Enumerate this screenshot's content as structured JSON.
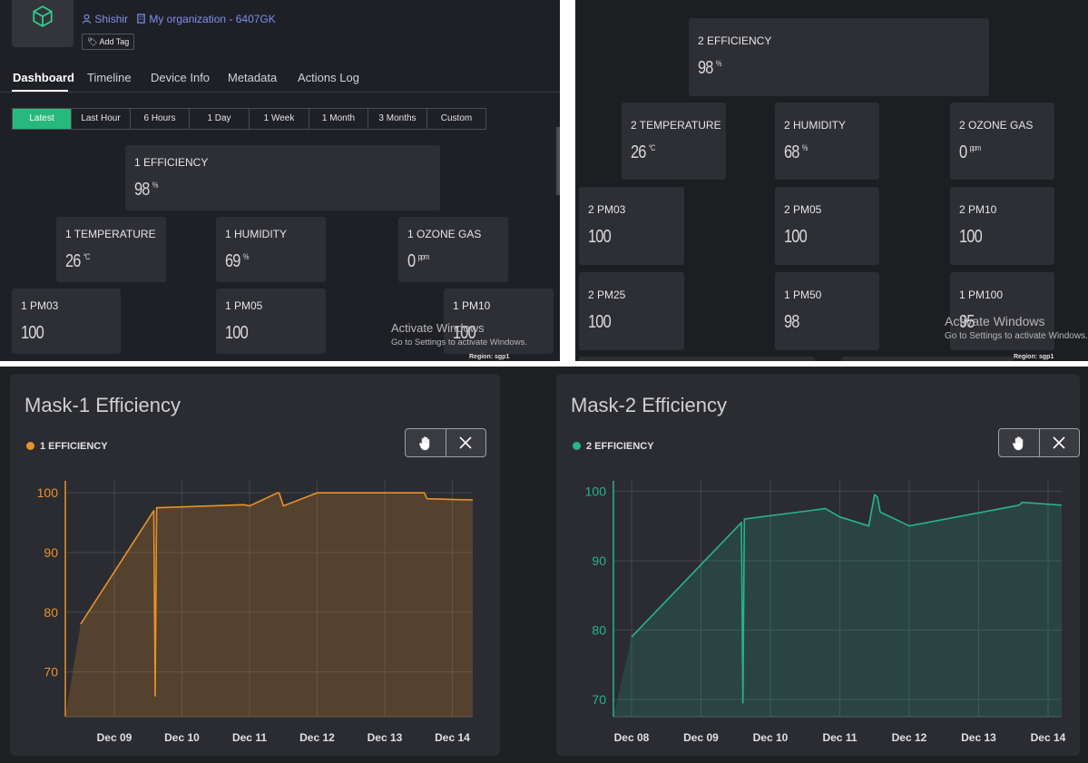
{
  "header": {
    "user_name": "Shishir",
    "org_name": "My organization - 6407GK",
    "add_tag_label": "Add Tag"
  },
  "tabs": [
    "Dashboard",
    "Timeline",
    "Device Info",
    "Metadata",
    "Actions Log"
  ],
  "time_ranges": [
    "Latest",
    "Last Hour",
    "6 Hours",
    "1 Day",
    "1 Week",
    "1 Month",
    "3 Months",
    "Custom"
  ],
  "mask1_cards": {
    "efficiency": {
      "label": "1 EFFICIENCY",
      "value": "98",
      "unit": "%"
    },
    "temperature": {
      "label": "1 TEMPERATURE",
      "value": "26",
      "unit": "°C"
    },
    "humidity": {
      "label": "1 HUMIDITY",
      "value": "69",
      "unit": "%"
    },
    "ozone": {
      "label": "1 OZONE GAS",
      "value": "0",
      "unit": "ppm"
    },
    "pm03": {
      "label": "1 PM03",
      "value": "100"
    },
    "pm05": {
      "label": "1 PM05",
      "value": "100"
    },
    "pm10": {
      "label": "1 PM10",
      "value": "100"
    }
  },
  "mask2_cards": {
    "efficiency": {
      "label": "2 EFFICIENCY",
      "value": "98",
      "unit": "%"
    },
    "temperature": {
      "label": "2 TEMPERATURE",
      "value": "26",
      "unit": "°C"
    },
    "humidity": {
      "label": "2 HUMIDITY",
      "value": "68",
      "unit": "%"
    },
    "ozone": {
      "label": "2 OZONE GAS",
      "value": "0",
      "unit": "ppm"
    },
    "pm03": {
      "label": "2 PM03",
      "value": "100"
    },
    "pm05": {
      "label": "2 PM05",
      "value": "100"
    },
    "pm10": {
      "label": "2 PM10",
      "value": "100"
    },
    "pm25": {
      "label": "2 PM25",
      "value": "100"
    },
    "pm50": {
      "label": "1 PM50",
      "value": "98"
    },
    "pm100": {
      "label": "1 PM100",
      "value": "95"
    }
  },
  "watermark": {
    "title": "Activate Windows",
    "subtitle": "Go to Settings to activate Windows."
  },
  "footer_region": "Region: sgp1",
  "colors": {
    "accent_green": "#27b97b",
    "mask1_line": "#e8922a",
    "mask2_line": "#26b58a"
  },
  "chart_data": [
    {
      "type": "area",
      "title": "Mask-1 Efficiency",
      "series": [
        {
          "name": "1 EFFICIENCY",
          "color": "#e8922a",
          "x": [
            "2023-12-08T12:00",
            "2023-12-09T14:00",
            "2023-12-09T14:30",
            "2023-12-09T15:00",
            "2023-12-09T16:00",
            "2023-12-10T22:00",
            "2023-12-11T00:00",
            "2023-12-11T10:00",
            "2023-12-11T10:30",
            "2023-12-11T12:00",
            "2023-12-12T00:00",
            "2023-12-13T14:00",
            "2023-12-13T15:00",
            "2023-12-14T12:00"
          ],
          "y": [
            78,
            97,
            66,
            97.5,
            97.5,
            98,
            97.8,
            100,
            100,
            97.8,
            100,
            100,
            99,
            98.8
          ]
        }
      ],
      "xticks": [
        "Dec 09",
        "Dec 10",
        "Dec 11",
        "Dec 12",
        "Dec 13",
        "Dec 14"
      ],
      "yticks": [
        70,
        80,
        90,
        100
      ],
      "ylim": [
        62.5,
        102
      ],
      "grid": true,
      "legend": "top-left"
    },
    {
      "type": "area",
      "title": "Mask-2 Efficiency",
      "series": [
        {
          "name": "2 EFFICIENCY",
          "color": "#26b58a",
          "x": [
            "2023-12-08T00:00",
            "2023-12-09T14:00",
            "2023-12-09T14:30",
            "2023-12-09T15:00",
            "2023-12-10T19:00",
            "2023-12-11T00:00",
            "2023-12-11T10:00",
            "2023-12-11T12:00",
            "2023-12-11T13:00",
            "2023-12-11T14:00",
            "2023-12-12T00:00",
            "2023-12-13T14:00",
            "2023-12-13T15:00",
            "2023-12-14T12:00"
          ],
          "y": [
            79,
            95.5,
            69.5,
            96,
            97.5,
            96.3,
            95,
            99.5,
            99.2,
            97,
            95,
            98,
            98.4,
            98
          ]
        }
      ],
      "xticks": [
        "Dec 08",
        "Dec 09",
        "Dec 10",
        "Dec 11",
        "Dec 12",
        "Dec 13",
        "Dec 14"
      ],
      "yticks": [
        70,
        80,
        90,
        100
      ],
      "ylim": [
        67.5,
        101.5
      ],
      "grid": true,
      "legend": "top-left"
    }
  ]
}
